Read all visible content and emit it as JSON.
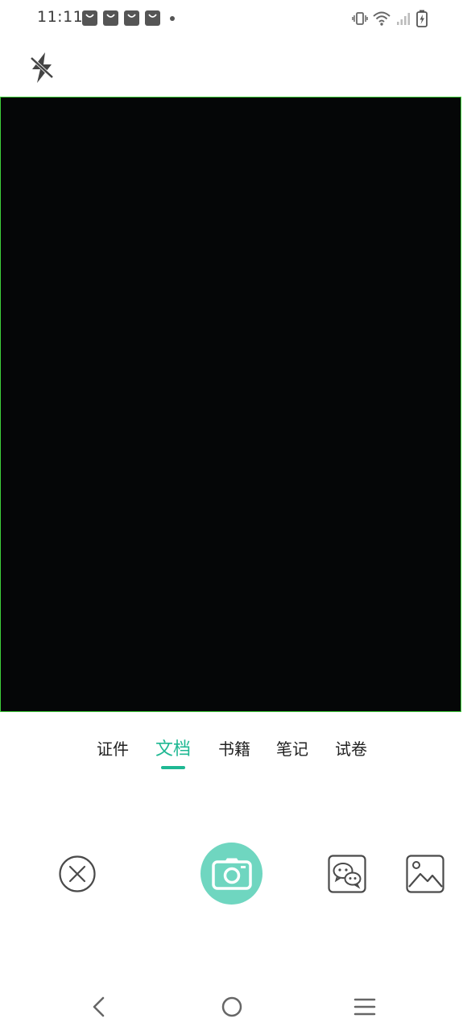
{
  "status_bar": {
    "time": "11:11",
    "notification_icons": [
      "shopping-bag-icon",
      "shopping-bag-icon",
      "shopping-bag-icon",
      "shopping-bag-icon"
    ],
    "system_icons": [
      "vibrate-icon",
      "wifi-icon",
      "signal-icon",
      "battery-charging-icon"
    ]
  },
  "toolbar": {
    "flash_icon": "flash-off-icon"
  },
  "mode_tabs": {
    "items": [
      {
        "label": "证件"
      },
      {
        "label": "文档"
      },
      {
        "label": "书籍"
      },
      {
        "label": "笔记"
      },
      {
        "label": "试卷"
      }
    ],
    "selected": "文档"
  },
  "colors": {
    "accent": "#1fb893",
    "shutter": "#6fd6c0",
    "preview_bg": "#050607",
    "preview_border": "#3fcf3a",
    "icon": "#4a4a4a"
  },
  "controls": {
    "close_icon": "close-circle-icon",
    "shutter_icon": "camera-icon",
    "wechat_icon": "wechat-icon",
    "gallery_icon": "gallery-icon"
  },
  "nav_bar": {
    "icons": [
      "back-icon",
      "home-icon",
      "menu-icon"
    ]
  }
}
